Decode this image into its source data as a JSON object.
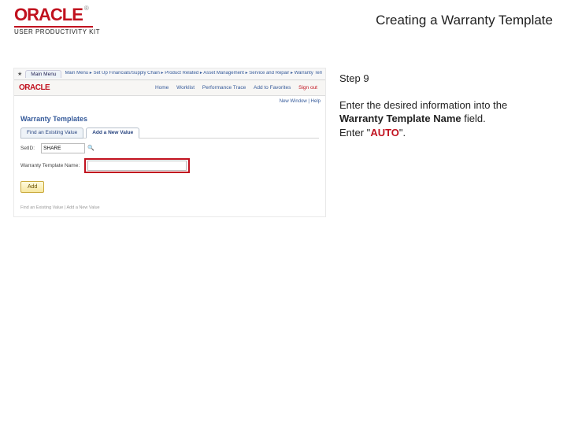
{
  "brand": {
    "name": "ORACLE",
    "product": "USER PRODUCTIVITY KIT"
  },
  "page_title": "Creating a Warranty Template",
  "screenshot": {
    "browser": {
      "tab": "Main Menu",
      "crumbs": "Main Menu  ▸  Set Up Financials/Supply Chain  ▸  Product Related  ▸  Asset Management  ▸  Service and Repair  ▸  Warranty Templates"
    },
    "appbar": {
      "logo": "ORACLE",
      "nav": {
        "home": "Home",
        "worklist": "Worklist",
        "perf": "Performance Trace",
        "add": "Add to Favorites",
        "signout": "Sign out"
      },
      "util": "New Window | Help"
    },
    "page_subtitle": "Warranty Templates",
    "tabs": {
      "find": "Find an Existing Value",
      "add": "Add a New Value"
    },
    "form": {
      "setid_label": "SetID:",
      "setid_value": "SHARE",
      "wtn_label": "Warranty Template Name:",
      "wtn_value": ""
    },
    "add_button": "Add",
    "footer": "Find an Existing Value | Add a New Value"
  },
  "instruction": {
    "step": "Step 9",
    "line1a": "Enter the desired information into the ",
    "line1b": "Warranty Template Name",
    "line1c": " field.",
    "line2a": "Enter \"",
    "line2b": "AUTO",
    "line2c": "\"."
  }
}
